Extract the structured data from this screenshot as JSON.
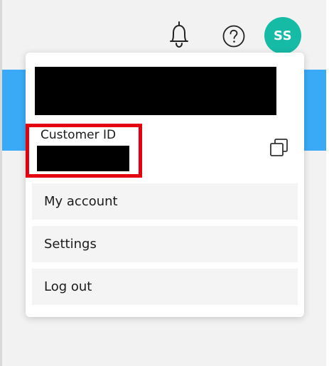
{
  "header": {
    "notifications_icon": "bell-icon",
    "help_icon": "question-circle-icon",
    "avatar_initials": "SS",
    "avatar_color": "#16bba6",
    "banner_color": "#3aaaf7"
  },
  "account_menu": {
    "customer_id_label": "Customer ID",
    "copy_icon": "copy-icon",
    "highlight_color": "#e3000f",
    "items": [
      {
        "label": "My account"
      },
      {
        "label": "Settings"
      },
      {
        "label": "Log out"
      }
    ]
  }
}
